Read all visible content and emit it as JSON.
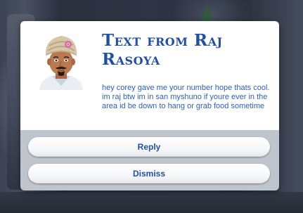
{
  "notification": {
    "title": "Text from Raj Rasoya",
    "message": "hey corey gave me your number hope thats cool. im raj btw im in san myshuno if youre ever in the area id be down to hang or grab food sometime",
    "portrait_icon": "sim-portrait-turban-man",
    "buttons": {
      "reply_label": "Reply",
      "dismiss_label": "Dismiss"
    }
  },
  "colors": {
    "title": "#1f4fa6",
    "message": "#2b5fbf",
    "button_text": "#1f4fa6",
    "panel_bottom": "#bfc5cd"
  }
}
